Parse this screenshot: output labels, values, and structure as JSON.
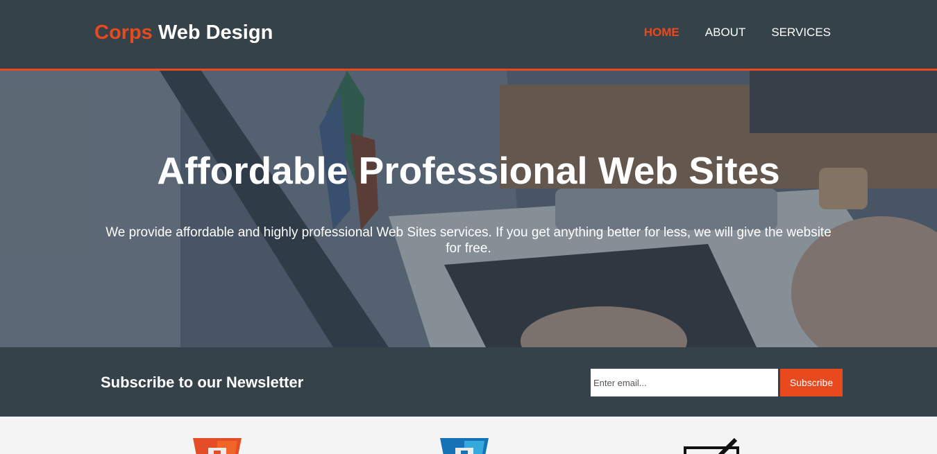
{
  "header": {
    "logo_highlight": "Corps",
    "logo_rest": " Web Design",
    "nav": [
      {
        "label": "HOME",
        "current": true
      },
      {
        "label": "ABOUT",
        "current": false
      },
      {
        "label": "SERVICES",
        "current": false
      }
    ]
  },
  "hero": {
    "heading": "Affordable Professional Web Sites",
    "text": "We provide affordable and highly professional Web Sites services. If you get anything better for less, we will give the website for free."
  },
  "newsletter": {
    "heading": "Subscribe to our Newsletter",
    "email_placeholder": "Enter email...",
    "subscribe_label": "Subscribe"
  },
  "boxes": {
    "icons": [
      "html5-logo-icon",
      "css3-logo-icon",
      "design-pen-icon"
    ]
  },
  "colors": {
    "accent": "#e8491d",
    "dark": "#35424a",
    "light": "#f4f4f4"
  }
}
